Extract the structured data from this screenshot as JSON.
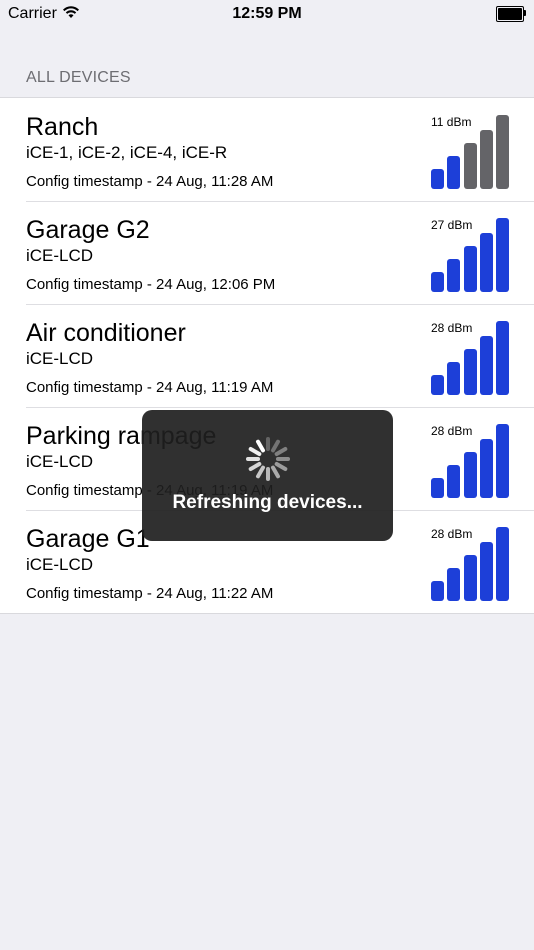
{
  "status_bar": {
    "carrier": "Carrier",
    "time": "12:59 PM"
  },
  "section_header": "ALL DEVICES",
  "colors": {
    "active_bar": "#1d3fd8",
    "inactive_bar": "#646468",
    "hud_bg": "#1e1e1e"
  },
  "devices": [
    {
      "name": "Ranch",
      "models": "iCE-1, iCE-2, iCE-4, iCE-R",
      "timestamp": "Config timestamp - 24 Aug, 11:28 AM",
      "signal": "11 dBm",
      "signal_bars_active": 2,
      "signal_bars_total": 5
    },
    {
      "name": "Garage G2",
      "models": "iCE-LCD",
      "timestamp": "Config timestamp - 24 Aug, 12:06 PM",
      "signal": "27 dBm",
      "signal_bars_active": 5,
      "signal_bars_total": 5
    },
    {
      "name": "Air conditioner",
      "models": "iCE-LCD",
      "timestamp": "Config timestamp - 24 Aug, 11:19 AM",
      "signal": "28 dBm",
      "signal_bars_active": 5,
      "signal_bars_total": 5
    },
    {
      "name": "Parking rampage",
      "models": "iCE-LCD",
      "timestamp": "Config timestamp - 24 Aug, 11:19 AM",
      "signal": "28 dBm",
      "signal_bars_active": 5,
      "signal_bars_total": 5
    },
    {
      "name": "Garage G1",
      "models": "iCE-LCD",
      "timestamp": "Config timestamp - 24 Aug, 11:22 AM",
      "signal": "28 dBm",
      "signal_bars_active": 5,
      "signal_bars_total": 5
    }
  ],
  "hud": {
    "message": "Refreshing devices..."
  }
}
